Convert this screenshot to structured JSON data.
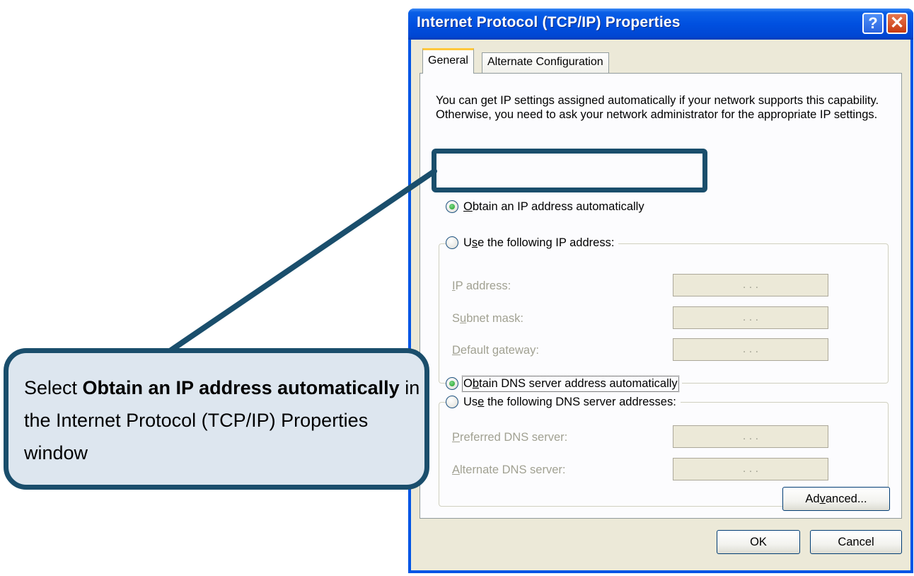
{
  "window": {
    "title": "Internet Protocol (TCP/IP) Properties",
    "help_label": "?",
    "close_label": "✕"
  },
  "tabs": [
    {
      "label": "General",
      "active": true
    },
    {
      "label": "Alternate Configuration",
      "active": false
    }
  ],
  "description": "You can get IP settings assigned automatically if your network supports this capability. Otherwise, you need to ask your network administrator for the appropriate IP settings.",
  "ip_options": {
    "auto": {
      "access": "O",
      "rest": "btain an IP address automatically",
      "selected": true
    },
    "manual": {
      "pre": "U",
      "access": "s",
      "rest": "e the following IP address:",
      "selected": false
    }
  },
  "ip_fields": [
    {
      "access": "I",
      "rest": "P address:",
      "pre": "",
      "value": ". . ."
    },
    {
      "pre": "S",
      "access": "u",
      "rest": "bnet mask:",
      "value": ". . ."
    },
    {
      "pre": "",
      "access": "D",
      "rest": "efault gateway:",
      "value": ". . ."
    }
  ],
  "dns_options": {
    "auto": {
      "pre": "O",
      "access": "b",
      "rest": "tain DNS server address automatically",
      "selected": true
    },
    "manual": {
      "pre": "Us",
      "access": "e",
      "rest": " the following DNS server addresses:",
      "selected": false
    }
  },
  "dns_fields": [
    {
      "pre": "",
      "access": "P",
      "rest": "referred DNS server:",
      "value": ". . ."
    },
    {
      "pre": "",
      "access": "A",
      "rest": "lternate DNS server:",
      "value": ". . ."
    }
  ],
  "buttons": {
    "advanced": {
      "pre": "Ad",
      "access": "v",
      "rest": "anced..."
    },
    "ok": "OK",
    "cancel": "Cancel"
  },
  "callout": {
    "pre": "Select ",
    "bold": "Obtain an IP address automatically",
    "post": " in the Internet Protocol (TCP/IP) Properties window"
  },
  "colors": {
    "callout_border": "#1a4e6c",
    "callout_fill": "#dde6ef",
    "titlebar": "#0050e0",
    "dialog_face": "#ece9d8"
  }
}
